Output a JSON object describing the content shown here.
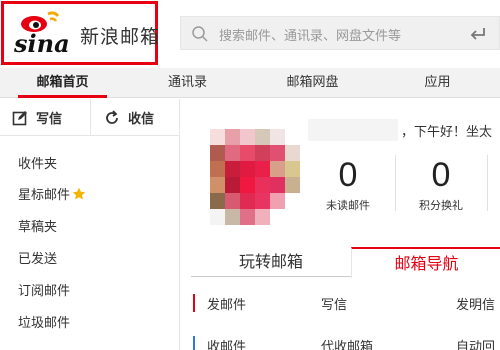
{
  "brand": {
    "logo_text": "新浪邮箱",
    "accent": "#e60012"
  },
  "search": {
    "placeholder": "搜索邮件、通讯录、网盘文件等"
  },
  "tabs": [
    {
      "label": "邮箱首页",
      "active": true
    },
    {
      "label": "通讯录",
      "active": false
    },
    {
      "label": "邮箱网盘",
      "active": false
    },
    {
      "label": "应用",
      "active": false
    }
  ],
  "sidebar": {
    "compose_label": "写信",
    "receive_label": "收信",
    "folders": [
      {
        "label": "收件夹"
      },
      {
        "label": "星标邮件",
        "icon": "star-icon"
      },
      {
        "label": "草稿夹"
      },
      {
        "label": "已发送"
      },
      {
        "label": "订阅邮件"
      },
      {
        "label": "垃圾邮件"
      }
    ]
  },
  "main": {
    "greeting": "，下午好！坐太",
    "stats": [
      {
        "value": "0",
        "label": "未读邮件"
      },
      {
        "value": "0",
        "label": "积分换礼"
      }
    ],
    "sub_tabs": [
      {
        "label": "玩转邮箱",
        "active": false
      },
      {
        "label": "邮箱导航",
        "active": true
      }
    ],
    "nav_rows": [
      {
        "label": "发邮件",
        "a": "写信",
        "b": "发明信",
        "bar_color": "#e60012"
      },
      {
        "label": "收邮件",
        "a": "代收邮箱",
        "b": "自动回",
        "bar_color": "#2b7bd6"
      }
    ]
  }
}
